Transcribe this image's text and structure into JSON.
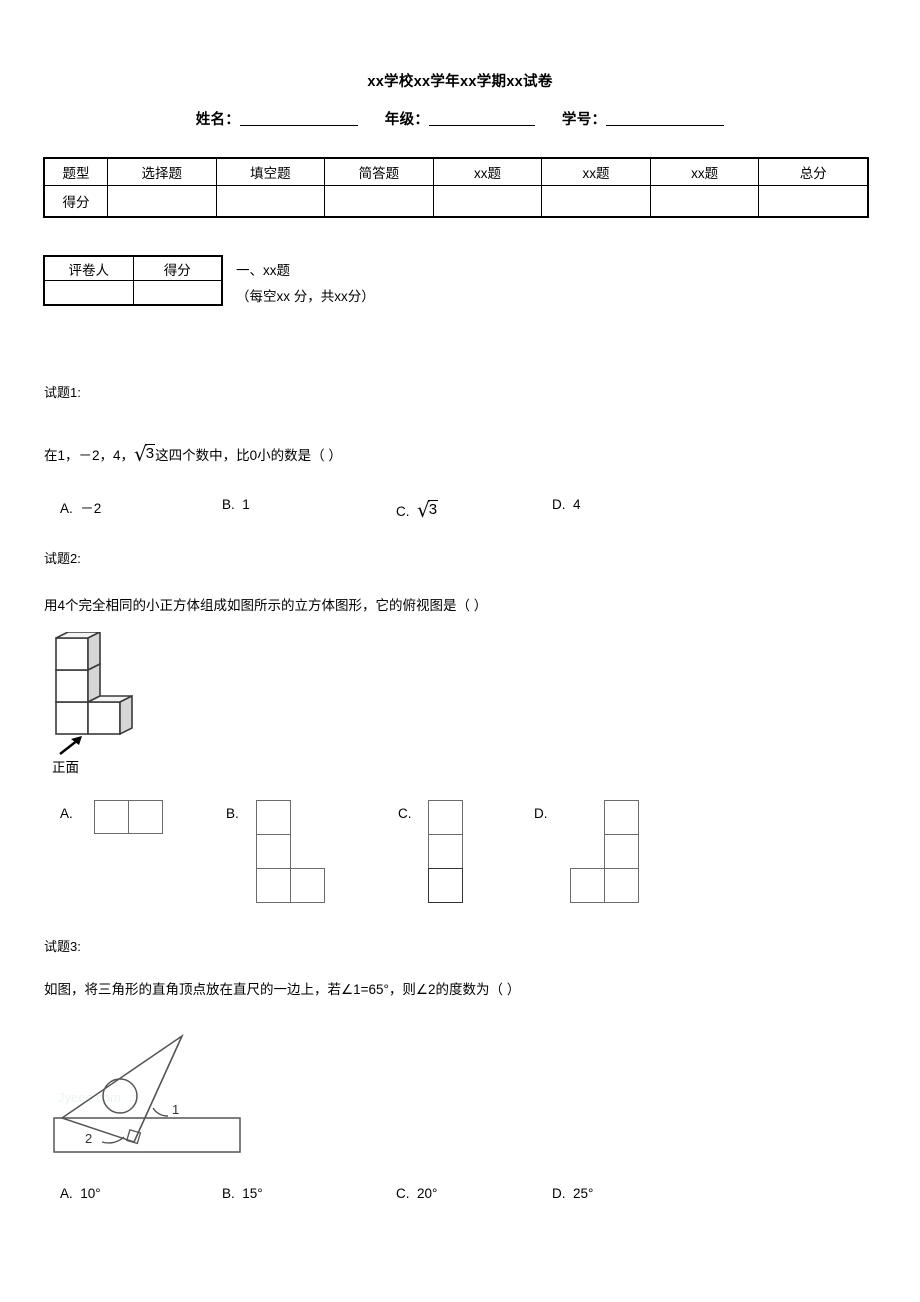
{
  "header": {
    "title": "xx学校xx学年xx学期xx试卷",
    "fields": [
      {
        "label": "姓名："
      },
      {
        "label": "年级："
      },
      {
        "label": "学号："
      }
    ]
  },
  "score_table": {
    "headers": [
      "题型",
      "选择题",
      "填空题",
      "简答题",
      "xx题",
      "xx题",
      "xx题",
      "总分"
    ],
    "row_label": "得分",
    "row_values": [
      "",
      "",
      "",
      "",
      "",
      "",
      ""
    ]
  },
  "grader_table": {
    "headers": [
      "评卷人",
      "得分"
    ],
    "values": [
      "",
      ""
    ]
  },
  "section": {
    "title": "一、xx题",
    "subtitle": "（每空xx 分，共xx分）"
  },
  "questions": [
    {
      "label": "试题1:",
      "text_before": "在1，－2，4，",
      "radical": "3",
      "text_after": "这四个数中，比0小的数是（    ）",
      "options": [
        {
          "key": "A.",
          "value": "－2"
        },
        {
          "key": "B.",
          "value": "1"
        },
        {
          "key": "C.",
          "value": "√3"
        },
        {
          "key": "D.",
          "value": "4"
        }
      ]
    },
    {
      "label": "试题2:",
      "text": "用4个完全相同的小正方体组成如图所示的立方体图形，它的俯视图是（    ）",
      "figure_caption": "正面",
      "options": [
        {
          "key": "A."
        },
        {
          "key": "B."
        },
        {
          "key": "C."
        },
        {
          "key": "D."
        }
      ]
    },
    {
      "label": "试题3:",
      "text": "如图，将三角形的直角顶点放在直尺的一边上，若∠1=65°，则∠2的度数为（    ）",
      "figure_angles": [
        "1",
        "2"
      ],
      "options": [
        {
          "key": "A.",
          "value": "10°"
        },
        {
          "key": "B.",
          "value": "15°"
        },
        {
          "key": "C.",
          "value": "20°"
        },
        {
          "key": "D.",
          "value": "25°"
        }
      ]
    }
  ],
  "watermark": "Jyeoo.com",
  "colors": {
    "line": "#000000",
    "cell_stroke": "#6b6b6b",
    "cube_shade": "#d9d9d9",
    "cube_top": "#f2f2f2"
  }
}
